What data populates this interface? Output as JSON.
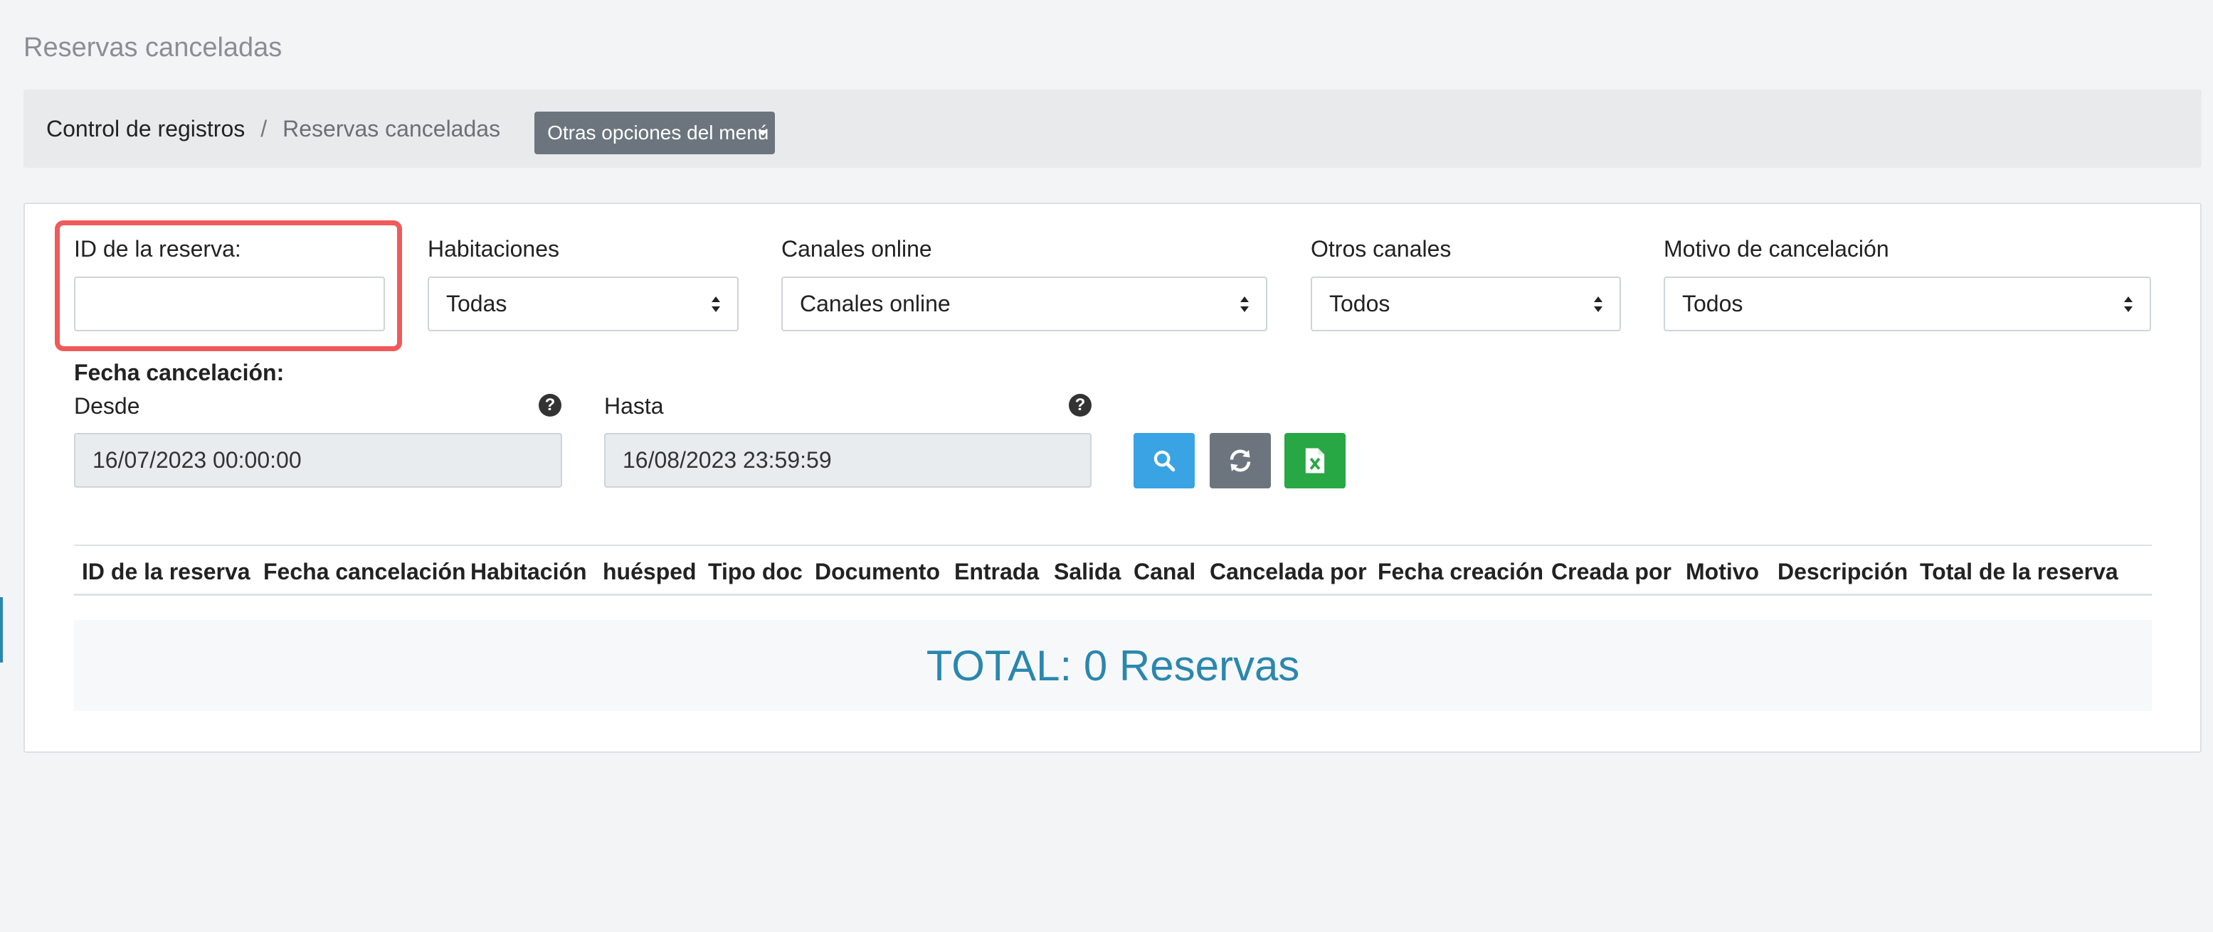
{
  "page": {
    "title": "Reservas canceladas"
  },
  "breadcrumb": {
    "items": [
      "Control de registros",
      "Reservas canceladas"
    ],
    "separator": "/",
    "menu_button": "Otras opciones del menú"
  },
  "filters": {
    "reservation_id": {
      "label": "ID de la reserva:",
      "value": ""
    },
    "rooms": {
      "label": "Habitaciones",
      "selected": "Todas"
    },
    "online_channels": {
      "label": "Canales online",
      "selected": "Canales online"
    },
    "other_channels": {
      "label": "Otros canales",
      "selected": "Todos"
    },
    "cancel_reason": {
      "label": "Motivo de cancelación",
      "selected": "Todos"
    },
    "cancel_date": {
      "label": "Fecha cancelación:",
      "from_label": "Desde",
      "from_value": "16/07/2023 00:00:00",
      "to_label": "Hasta",
      "to_value": "16/08/2023 23:59:59",
      "help": "?"
    }
  },
  "actions": {
    "search_icon": "search-icon",
    "refresh_icon": "refresh-icon",
    "excel_icon": "excel-icon"
  },
  "table": {
    "columns": [
      "ID de la reserva",
      "Fecha cancelación",
      "Habitación",
      "huésped",
      "Tipo doc",
      "Documento",
      "Entrada",
      "Salida",
      "Canal",
      "Cancelada por",
      "Fecha creación",
      "Creada por",
      "Motivo",
      "Descripción",
      "Total de la reserva"
    ],
    "total_text": "TOTAL: 0 Reservas"
  },
  "colors": {
    "highlight": "#f05a5a",
    "search_button": "#3aa3e3",
    "refresh_button": "#6c757d",
    "excel_button": "#28a745",
    "total_text": "#2a87ad"
  }
}
